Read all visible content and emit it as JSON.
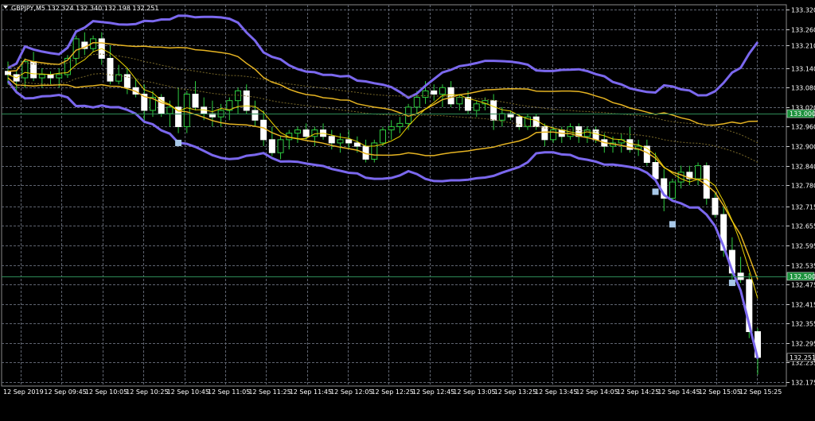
{
  "chart_data": {
    "type": "candlestick",
    "symbol_header": "GBPJPY,M5  132.324 132.340 132.198 132.251",
    "y_ticks": [
      "133.320",
      "133.260",
      "133.210",
      "133.140",
      "133.080",
      "133.020",
      "132.960",
      "132.900",
      "132.840",
      "132.780",
      "132.715",
      "132.655",
      "132.595",
      "132.535",
      "132.475",
      "132.415",
      "132.355",
      "132.295",
      "132.235",
      "132.175"
    ],
    "y_tick_values": [
      133.32,
      133.26,
      133.21,
      133.14,
      133.08,
      133.02,
      132.96,
      132.9,
      132.84,
      132.78,
      132.715,
      132.655,
      132.595,
      132.535,
      132.475,
      132.415,
      132.355,
      132.295,
      132.235,
      132.175
    ],
    "x_ticks": [
      "12 Sep 2019",
      "12 Sep 09:45",
      "12 Sep 10:05",
      "12 Sep 10:25",
      "12 Sep 10:45",
      "12 Sep 11:05",
      "12 Sep 11:25",
      "12 Sep 11:45",
      "12 Sep 12:05",
      "12 Sep 12:25",
      "12 Sep 12:45",
      "12 Sep 13:05",
      "12 Sep 13:25",
      "12 Sep 13:45",
      "12 Sep 14:05",
      "12 Sep 14:25",
      "12 Sep 14:45",
      "12 Sep 15:05",
      "12 Sep 15:25"
    ],
    "price_labels": [
      {
        "text": "133.000",
        "value": 133.0,
        "color": "#1a8f3a"
      },
      {
        "text": "132.500",
        "value": 132.5,
        "color": "#1a8f3a"
      },
      {
        "text": "132.251",
        "value": 132.251,
        "color": "#000000"
      }
    ],
    "hlines": [
      {
        "value": 133.0,
        "color": "#2e8b57"
      },
      {
        "value": 132.5,
        "color": "#2e8b57"
      }
    ],
    "ylim": [
      132.175,
      133.32
    ],
    "grid": true,
    "colors": {
      "background": "#000000",
      "grid": "#5f6470",
      "bull": "#ffffff",
      "bear": "#ffffff",
      "wick": "#2ecc40",
      "outer_band": "#7b68ee",
      "inner_band": "#e6b422",
      "dotted": "#7a6a2a",
      "markers": "#a8c8e8"
    },
    "candles": [
      [
        133.13,
        133.16,
        133.09,
        133.12
      ],
      [
        133.12,
        133.13,
        133.07,
        133.1
      ],
      [
        133.11,
        133.17,
        133.08,
        133.16
      ],
      [
        133.16,
        133.19,
        133.1,
        133.11
      ],
      [
        133.11,
        133.14,
        133.08,
        133.12
      ],
      [
        133.12,
        133.13,
        133.09,
        133.11
      ],
      [
        133.11,
        133.14,
        133.08,
        133.12
      ],
      [
        133.12,
        133.18,
        133.11,
        133.17
      ],
      [
        133.17,
        133.24,
        133.15,
        133.23
      ],
      [
        133.22,
        133.25,
        133.18,
        133.2
      ],
      [
        133.2,
        133.24,
        133.19,
        133.23
      ],
      [
        133.23,
        133.25,
        133.15,
        133.17
      ],
      [
        133.17,
        133.21,
        133.09,
        133.1
      ],
      [
        133.1,
        133.15,
        133.09,
        133.12
      ],
      [
        133.12,
        133.14,
        133.06,
        133.08
      ],
      [
        133.08,
        133.11,
        133.05,
        133.06
      ],
      [
        133.06,
        133.09,
        132.97,
        133.01
      ],
      [
        133.01,
        133.07,
        132.99,
        133.05
      ],
      [
        133.05,
        133.06,
        132.99,
        133.0
      ],
      [
        133.0,
        133.04,
        132.96,
        133.02
      ],
      [
        133.02,
        133.08,
        132.94,
        132.96
      ],
      [
        132.96,
        133.07,
        132.94,
        133.06
      ],
      [
        133.06,
        133.1,
        133.01,
        133.02
      ],
      [
        133.02,
        133.05,
        132.98,
        133.0
      ],
      [
        133.0,
        133.04,
        132.96,
        132.99
      ],
      [
        132.99,
        133.03,
        132.96,
        133.01
      ],
      [
        133.01,
        133.05,
        132.98,
        133.04
      ],
      [
        133.04,
        133.08,
        133.0,
        133.07
      ],
      [
        133.07,
        133.09,
        133.0,
        133.01
      ],
      [
        133.01,
        133.04,
        132.96,
        132.98
      ],
      [
        132.98,
        133.01,
        132.9,
        132.92
      ],
      [
        132.92,
        132.96,
        132.87,
        132.88
      ],
      [
        132.88,
        132.93,
        132.86,
        132.92
      ],
      [
        132.92,
        132.95,
        132.89,
        132.94
      ],
      [
        132.94,
        132.96,
        132.91,
        132.95
      ],
      [
        132.95,
        132.97,
        132.92,
        132.93
      ],
      [
        132.93,
        132.96,
        132.9,
        132.95
      ],
      [
        132.95,
        132.97,
        132.92,
        132.93
      ],
      [
        132.93,
        132.95,
        132.89,
        132.91
      ],
      [
        132.91,
        132.94,
        132.88,
        132.92
      ],
      [
        132.92,
        132.95,
        132.89,
        132.91
      ],
      [
        132.91,
        132.93,
        132.88,
        132.9
      ],
      [
        132.9,
        132.92,
        132.85,
        132.86
      ],
      [
        132.86,
        132.92,
        132.85,
        132.91
      ],
      [
        132.91,
        132.96,
        132.9,
        132.95
      ],
      [
        132.95,
        132.98,
        132.92,
        132.96
      ],
      [
        132.96,
        132.99,
        132.94,
        132.97
      ],
      [
        132.97,
        133.03,
        132.95,
        133.02
      ],
      [
        133.02,
        133.07,
        133.0,
        133.05
      ],
      [
        133.05,
        133.1,
        133.03,
        133.07
      ],
      [
        133.07,
        133.09,
        133.04,
        133.06
      ],
      [
        133.06,
        133.09,
        133.02,
        133.08
      ],
      [
        133.08,
        133.1,
        133.02,
        133.03
      ],
      [
        133.03,
        133.06,
        133.01,
        133.05
      ],
      [
        133.05,
        133.07,
        133.0,
        133.01
      ],
      [
        133.01,
        133.04,
        132.99,
        133.03
      ],
      [
        133.03,
        133.05,
        133.01,
        133.04
      ],
      [
        133.04,
        133.06,
        132.95,
        132.98
      ],
      [
        132.98,
        133.02,
        132.96,
        133.0
      ],
      [
        133.0,
        133.01,
        132.98,
        132.99
      ],
      [
        132.99,
        133.0,
        132.95,
        132.96
      ],
      [
        132.96,
        133.0,
        132.95,
        132.99
      ],
      [
        132.99,
        133.0,
        132.95,
        132.96
      ],
      [
        132.96,
        132.97,
        132.9,
        132.92
      ],
      [
        132.92,
        132.96,
        132.91,
        132.95
      ],
      [
        132.95,
        132.96,
        132.91,
        132.93
      ],
      [
        132.93,
        132.97,
        132.92,
        132.96
      ],
      [
        132.96,
        132.97,
        132.91,
        132.93
      ],
      [
        132.93,
        132.96,
        132.91,
        132.95
      ],
      [
        132.95,
        132.96,
        132.91,
        132.92
      ],
      [
        132.92,
        132.94,
        132.88,
        132.9
      ],
      [
        132.9,
        132.93,
        132.88,
        132.91
      ],
      [
        132.91,
        132.94,
        132.88,
        132.92
      ],
      [
        132.92,
        132.96,
        132.88,
        132.89
      ],
      [
        132.89,
        132.92,
        132.87,
        132.9
      ],
      [
        132.9,
        132.92,
        132.84,
        132.85
      ],
      [
        132.85,
        132.88,
        132.79,
        132.8
      ],
      [
        132.8,
        132.83,
        132.7,
        132.74
      ],
      [
        132.74,
        132.8,
        132.73,
        132.79
      ],
      [
        132.79,
        132.84,
        132.77,
        132.82
      ],
      [
        132.82,
        132.84,
        132.78,
        132.8
      ],
      [
        132.8,
        132.85,
        132.78,
        132.84
      ],
      [
        132.84,
        132.85,
        132.72,
        132.74
      ],
      [
        132.74,
        132.76,
        132.68,
        132.69
      ],
      [
        132.69,
        132.72,
        132.56,
        132.58
      ],
      [
        132.58,
        132.62,
        132.49,
        132.51
      ],
      [
        132.51,
        132.56,
        132.48,
        132.49
      ],
      [
        132.49,
        132.51,
        132.31,
        132.33
      ],
      [
        132.33,
        132.34,
        132.198,
        132.251
      ]
    ]
  }
}
